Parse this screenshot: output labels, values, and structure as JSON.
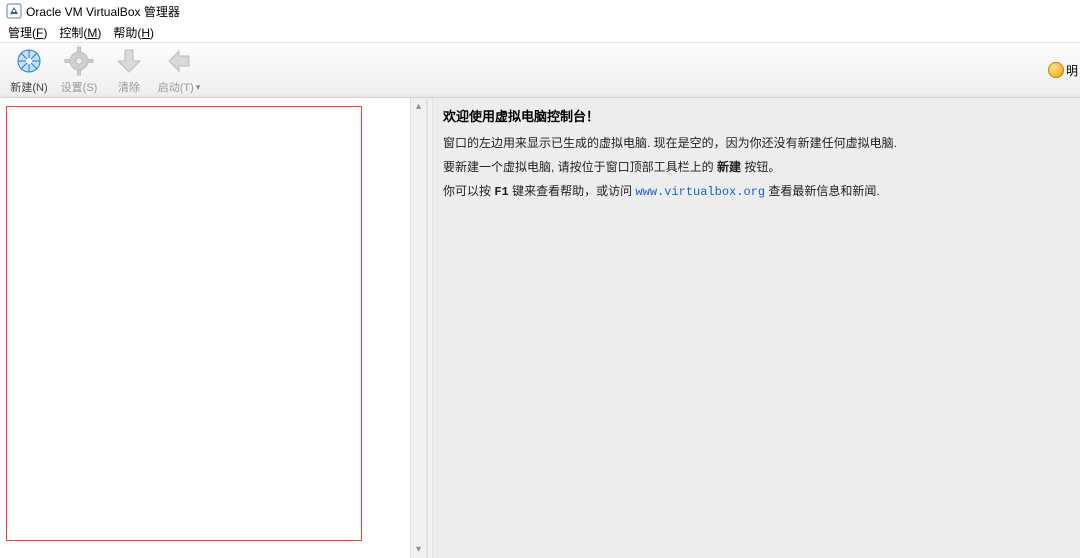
{
  "window": {
    "title": "Oracle VM VirtualBox 管理器"
  },
  "menu": {
    "manage": {
      "text_pre": "管理(",
      "accel": "F",
      "text_post": ")"
    },
    "control": {
      "text_pre": "控制(",
      "accel": "M",
      "text_post": ")"
    },
    "help": {
      "text_pre": "帮助(",
      "accel": "H",
      "text_post": ")"
    }
  },
  "toolbar": {
    "new_label": "新建(N)",
    "settings_label": "设置(S)",
    "discard_label": "清除",
    "start_label": "启动(T)",
    "right_label": "明"
  },
  "welcome": {
    "title": "欢迎使用虚拟电脑控制台！",
    "line1": "窗口的左边用来显示已生成的虚拟电脑. 现在是空的，因为你还没有新建任何虚拟电脑.",
    "line2_pre": "要新建一个虚拟电脑, 请按位于窗口顶部工具栏上的 ",
    "line2_bold": "新建",
    "line2_post": " 按钮。",
    "line3_pre": "你可以按 ",
    "line3_key": "F1",
    "line3_mid": " 键来查看帮助，或访问 ",
    "line3_link": "www.virtualbox.org",
    "line3_post": " 查看最新信息和新闻."
  }
}
